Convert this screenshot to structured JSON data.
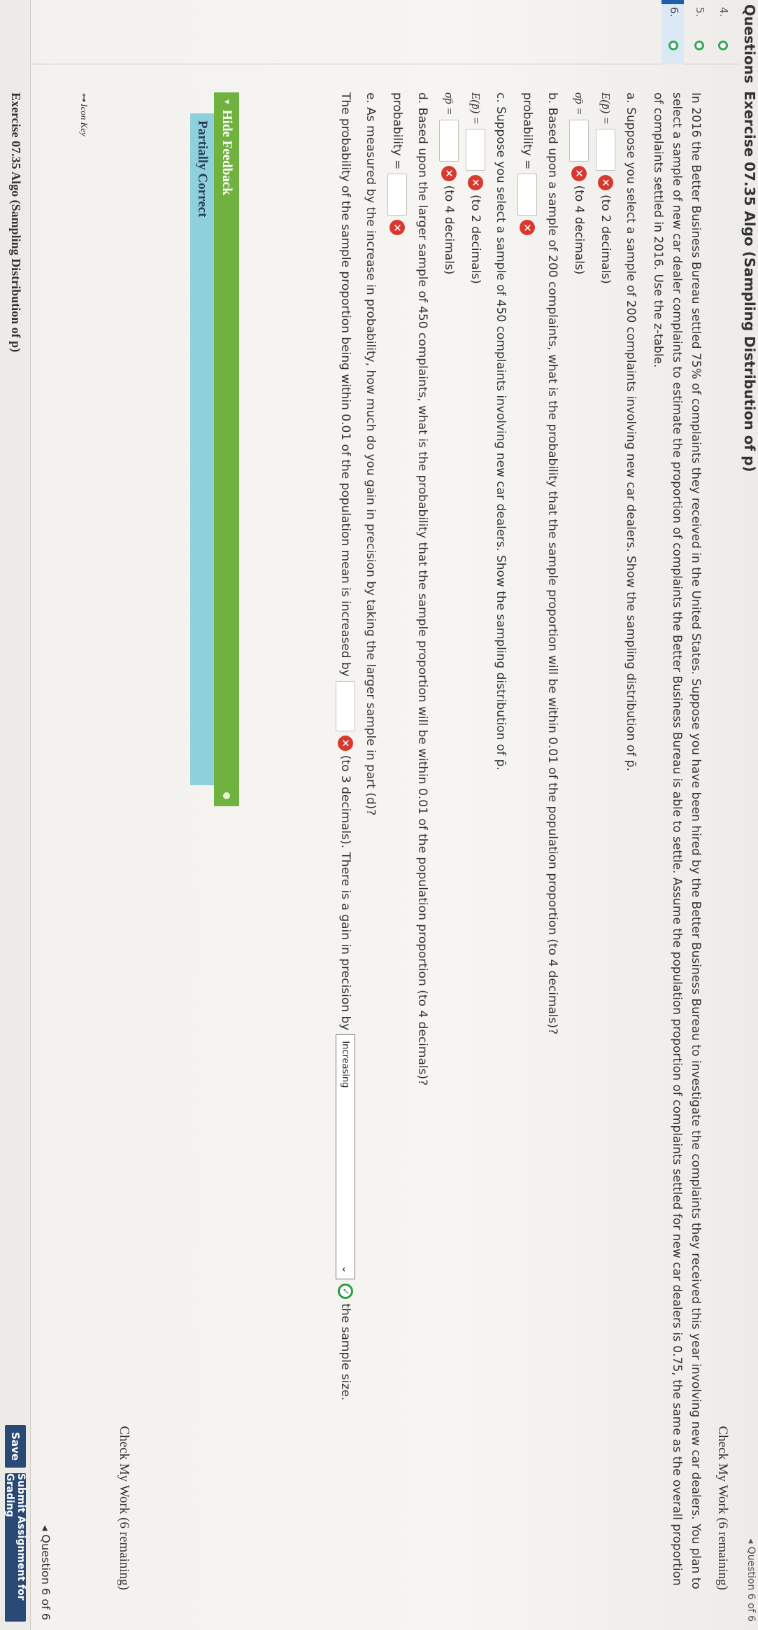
{
  "header": {
    "questions_label": "Questions",
    "exercise_title": "Exercise 07.35 Algo (Sampling Distribution of p)",
    "top_counter": "◂ Question 6 of 6"
  },
  "sidebar": {
    "questions": [
      {
        "num": "4.",
        "status": "complete"
      },
      {
        "num": "5.",
        "status": "complete"
      },
      {
        "num": "6.",
        "status": "active"
      }
    ]
  },
  "question": {
    "check_work_label": "Check My Work (6 remaining)",
    "intro": "In 2016 the Better Business Bureau settled 75% of complaints they received in the United States. Suppose you have been hired by the Better Business Bureau to investigate the complaints they received this year involving new car dealers. You plan to select a sample of new car dealer complaints to estimate the proportion of complaints the Better Business Bureau is able to settle. Assume the population proportion of complaints settled for new car dealers is 0.75, the same as the overall proportion of complaints settled in 2016. Use the z-table.",
    "part_a": "a. Suppose you select a sample of 200 complaints involving new car dealers. Show the sampling distribution of p̄.",
    "ep_label": "E(p̄) =",
    "ep_hint": "(to 2 decimals)",
    "sigma_label": "σp̄ =",
    "sigma_hint": "(to 4 decimals)",
    "part_b": "b. Based upon a sample of 200 complaints, what is the probability that the sample proportion will be within 0.01 of the population proportion (to 4 decimals)?",
    "prob_label": "probability =",
    "part_c": "c. Suppose you select a sample of 450 complaints involving new car dealers. Show the sampling distribution of p̄.",
    "part_d": "d. Based upon the larger sample of 450 complaints, what is the probability that the sample proportion will be within 0.01 of the population proportion (to 4 decimals)?",
    "part_e": "e. As measured by the increase in probability, how much do you gain in precision by taking the larger sample in part (d)?",
    "e_sentence_1": "The probability of the sample proportion being within 0.01 of the population mean is increased by",
    "e_sentence_2": "(to 3 decimals). There is a gain in precision by",
    "e_select_value": "Increasing",
    "e_sentence_3": "the sample size."
  },
  "feedback": {
    "hide_label": "Hide Feedback",
    "status": "Partially Correct"
  },
  "icon_key": "Icon Key",
  "bottom": {
    "exercise_title": "Exercise 07.35 Algo (Sampling Distribution of p)",
    "question_counter": "◂ Question 6 of 6",
    "save_label": "Save",
    "submit_label": "Submit Assignment for Grading"
  },
  "colors": {
    "feedback_green": "#6fb23f",
    "partial_blue": "#8ed1dd",
    "wrong_red": "#d8392f",
    "correct_green": "#2f9c46",
    "button_navy": "#2a4a76"
  }
}
